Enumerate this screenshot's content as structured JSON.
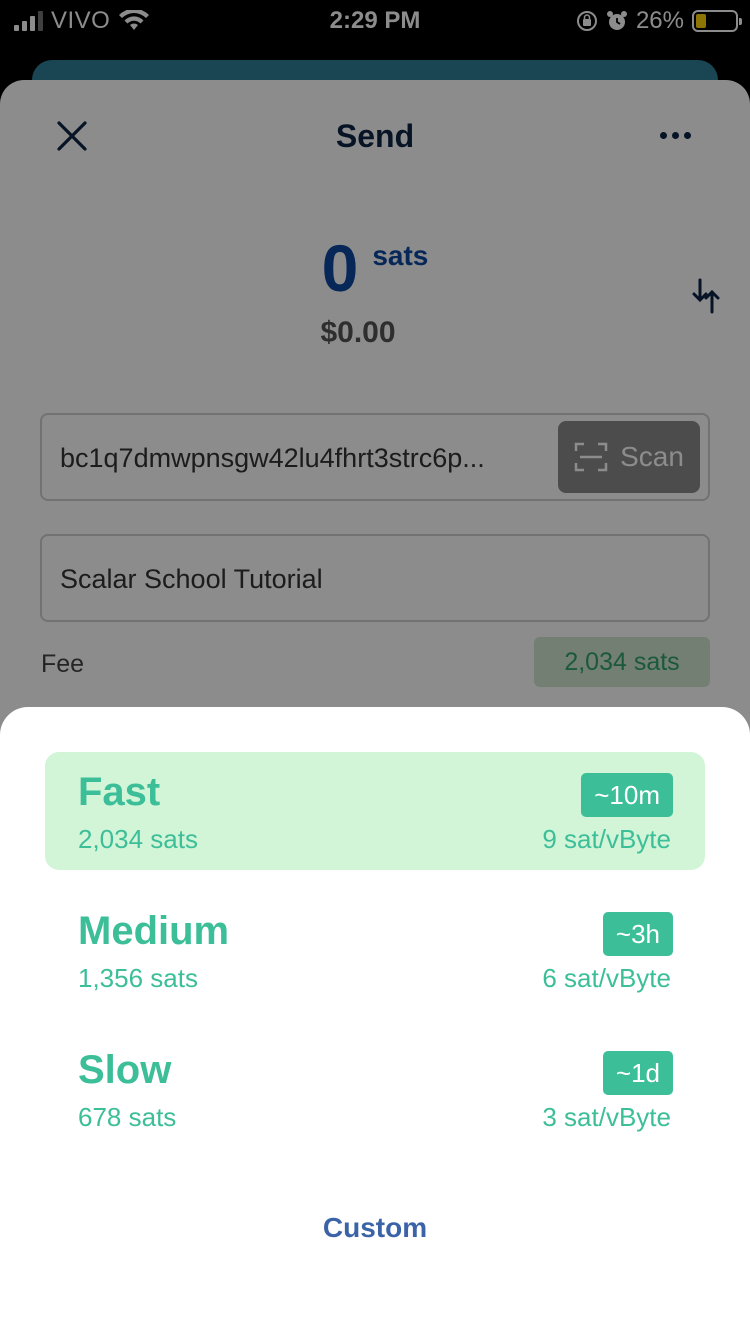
{
  "status_bar": {
    "carrier": "VIVO",
    "time": "2:29 PM",
    "battery": "26%",
    "battery_level": 0.26,
    "battery_color": "#ffd60a"
  },
  "background": {
    "title": "Send",
    "amount": "0",
    "unit": "sats",
    "fiat": "$0.00",
    "address": "bc1q7dmwpnsgw42lu4fhrt3strc6p...",
    "scan_label": "Scan",
    "note": "Scalar School Tutorial",
    "fee_label": "Fee",
    "fee_value": "2,034 sats"
  },
  "fee_sheet": {
    "options": [
      {
        "name": "Fast",
        "sats": "2,034 sats",
        "time": "~10m",
        "rate": "9 sat/vByte",
        "selected": true
      },
      {
        "name": "Medium",
        "sats": "1,356 sats",
        "time": "~3h",
        "rate": "6 sat/vByte",
        "selected": false
      },
      {
        "name": "Slow",
        "sats": "678 sats",
        "time": "~1d",
        "rate": "3 sat/vByte",
        "selected": false
      }
    ],
    "custom_label": "Custom"
  },
  "colors": {
    "accent_green": "#3cbf98",
    "selected_bg": "#d2f5d8",
    "brand_blue": "#0c47a1",
    "link_blue": "#3b64a8"
  }
}
